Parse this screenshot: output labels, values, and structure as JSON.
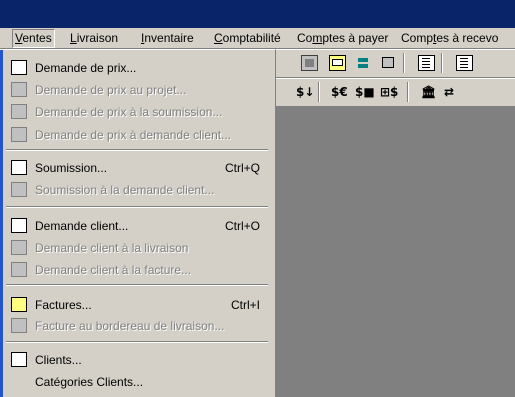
{
  "menubar": {
    "items": [
      {
        "label": "Ventes",
        "u": "V"
      },
      {
        "label": "Livraison",
        "u": "L"
      },
      {
        "label": "Inventaire",
        "u": "I"
      },
      {
        "label": "Comptabilité",
        "u": "C"
      },
      {
        "label": "Comptes à payer",
        "u": "m"
      },
      {
        "label": "Comptes à recevo",
        "u": "t"
      }
    ]
  },
  "toolbar2": {
    "t1": "$↓",
    "t2": "$€",
    "t3": "$■",
    "t4": "⊞$",
    "t5": "🏛"
  },
  "menu": {
    "items": [
      {
        "label": "Demande de prix...",
        "shortcut": "",
        "enabled": true,
        "icon": "price-request-icon"
      },
      {
        "label": "Demande de prix au projet...",
        "shortcut": "",
        "enabled": false,
        "icon": "project-price-icon"
      },
      {
        "label": "Demande de prix à la soumission...",
        "shortcut": "",
        "enabled": false,
        "icon": "price-submission-icon"
      },
      {
        "label": "Demande de prix à demande client...",
        "shortcut": "",
        "enabled": false,
        "icon": "price-client-request-icon"
      },
      {
        "label": "Soumission...",
        "shortcut": "Ctrl+Q",
        "enabled": true,
        "icon": "submission-icon"
      },
      {
        "label": "Soumission à la demande client...",
        "shortcut": "",
        "enabled": false,
        "icon": "submission-client-icon"
      },
      {
        "label": "Demande client...",
        "shortcut": "Ctrl+O",
        "enabled": true,
        "icon": "client-request-icon"
      },
      {
        "label": "Demande client à la livraison",
        "shortcut": "",
        "enabled": false,
        "icon": "client-delivery-icon"
      },
      {
        "label": "Demande client à la facture...",
        "shortcut": "",
        "enabled": false,
        "icon": "client-invoice-icon"
      },
      {
        "label": "Factures...",
        "shortcut": "Ctrl+I",
        "enabled": true,
        "icon": "invoices-icon"
      },
      {
        "label": "Facture au bordereau de livraison...",
        "shortcut": "",
        "enabled": false,
        "icon": "invoice-delivery-slip-icon"
      },
      {
        "label": "Clients...",
        "shortcut": "",
        "enabled": true,
        "icon": "clients-icon"
      },
      {
        "label": "Catégories Clients...",
        "shortcut": "",
        "enabled": true,
        "icon": ""
      }
    ]
  }
}
